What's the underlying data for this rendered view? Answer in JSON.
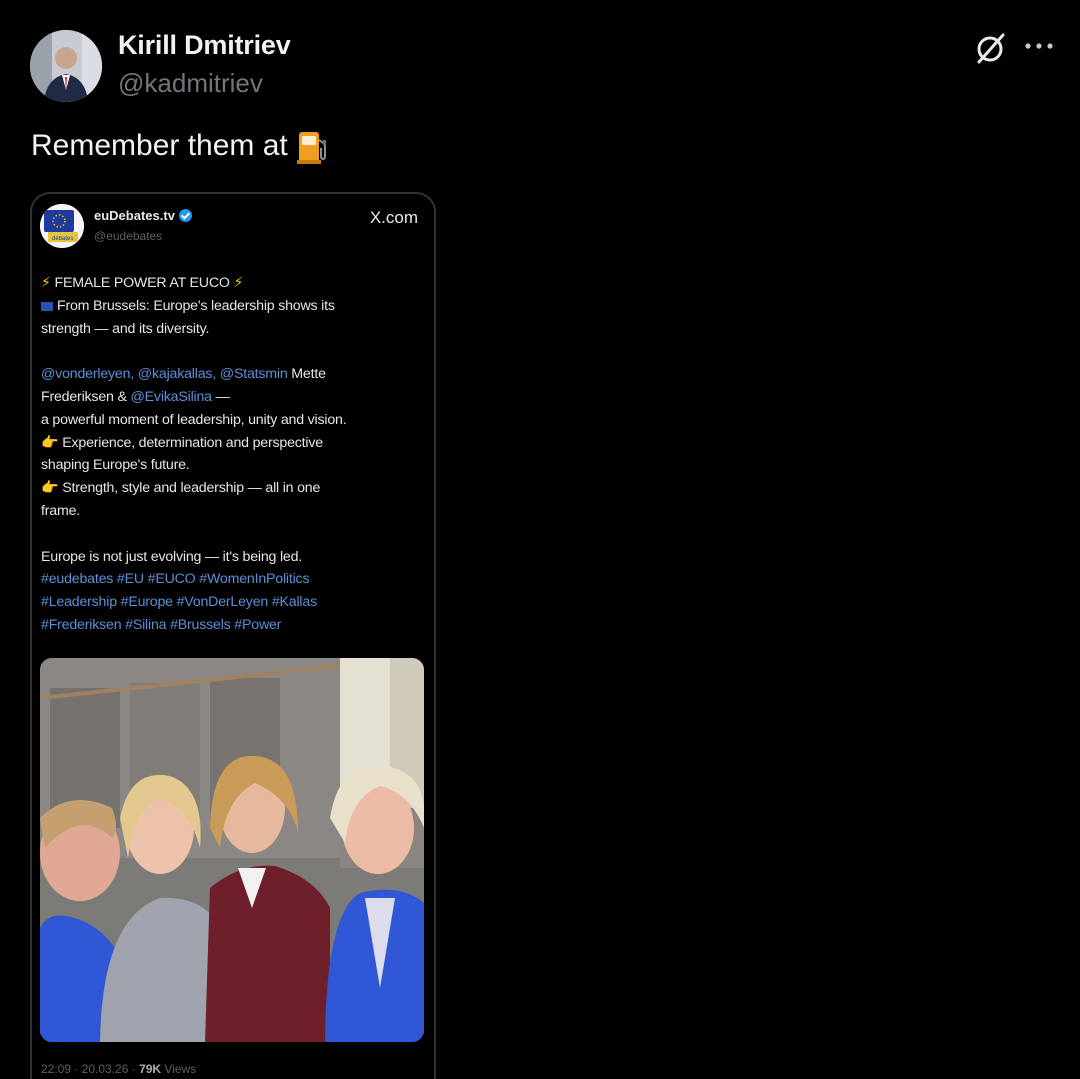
{
  "post": {
    "author_name": "Kirill Dmitriev",
    "author_handle": "@kadmitriev",
    "text": "Remember them at",
    "text_emoji": "fuel-pump-icon"
  },
  "quoted": {
    "author_name": "euDebates.tv",
    "author_handle": "@eudebates",
    "source_label": "X.com",
    "lines": {
      "l1": "FEMALE POWER AT EUCO",
      "l2": "From Brussels: Europe's leadership shows its",
      "l3": "strength — and its diversity.",
      "l4_mentions": "@vonderleyen, @kajakallas,  @Statsmin",
      "l4_text": " Mette",
      "l5_text": "Frederiksen & ",
      "l5_mention": "@EvikaSilina",
      "l5_tail": " —",
      "l6": " a powerful moment of leadership, unity and vision.",
      "l7": "Experience, determination and perspective",
      "l8": "shaping Europe's future.",
      "l9": "Strength, style and leadership — all in one",
      "l10": "frame.",
      "l11": "Europe is not just evolving — it's being led.",
      "l12": "#eudebates #EU #EUCO #WomenInPolitics",
      "l13": "#Leadership #Europe #VonDerLeyen #Kallas",
      "l14": "#Frederiksen #Silina #Brussels #Power"
    },
    "footer_time": "22:09 · 20.03.26 · ",
    "footer_views_count": "79K",
    "footer_views_label": " Views"
  },
  "colors": {
    "background": "#000000",
    "link": "#5c8fd6",
    "muted": "#71767b",
    "verified": "#1d9bf0"
  },
  "icons": {
    "header_right_1": "grok-icon",
    "header_right_2": "more-icon",
    "bolt": "lightning-icon",
    "hand": "pointing-hand-icon",
    "flag": "eu-flag-icon"
  }
}
